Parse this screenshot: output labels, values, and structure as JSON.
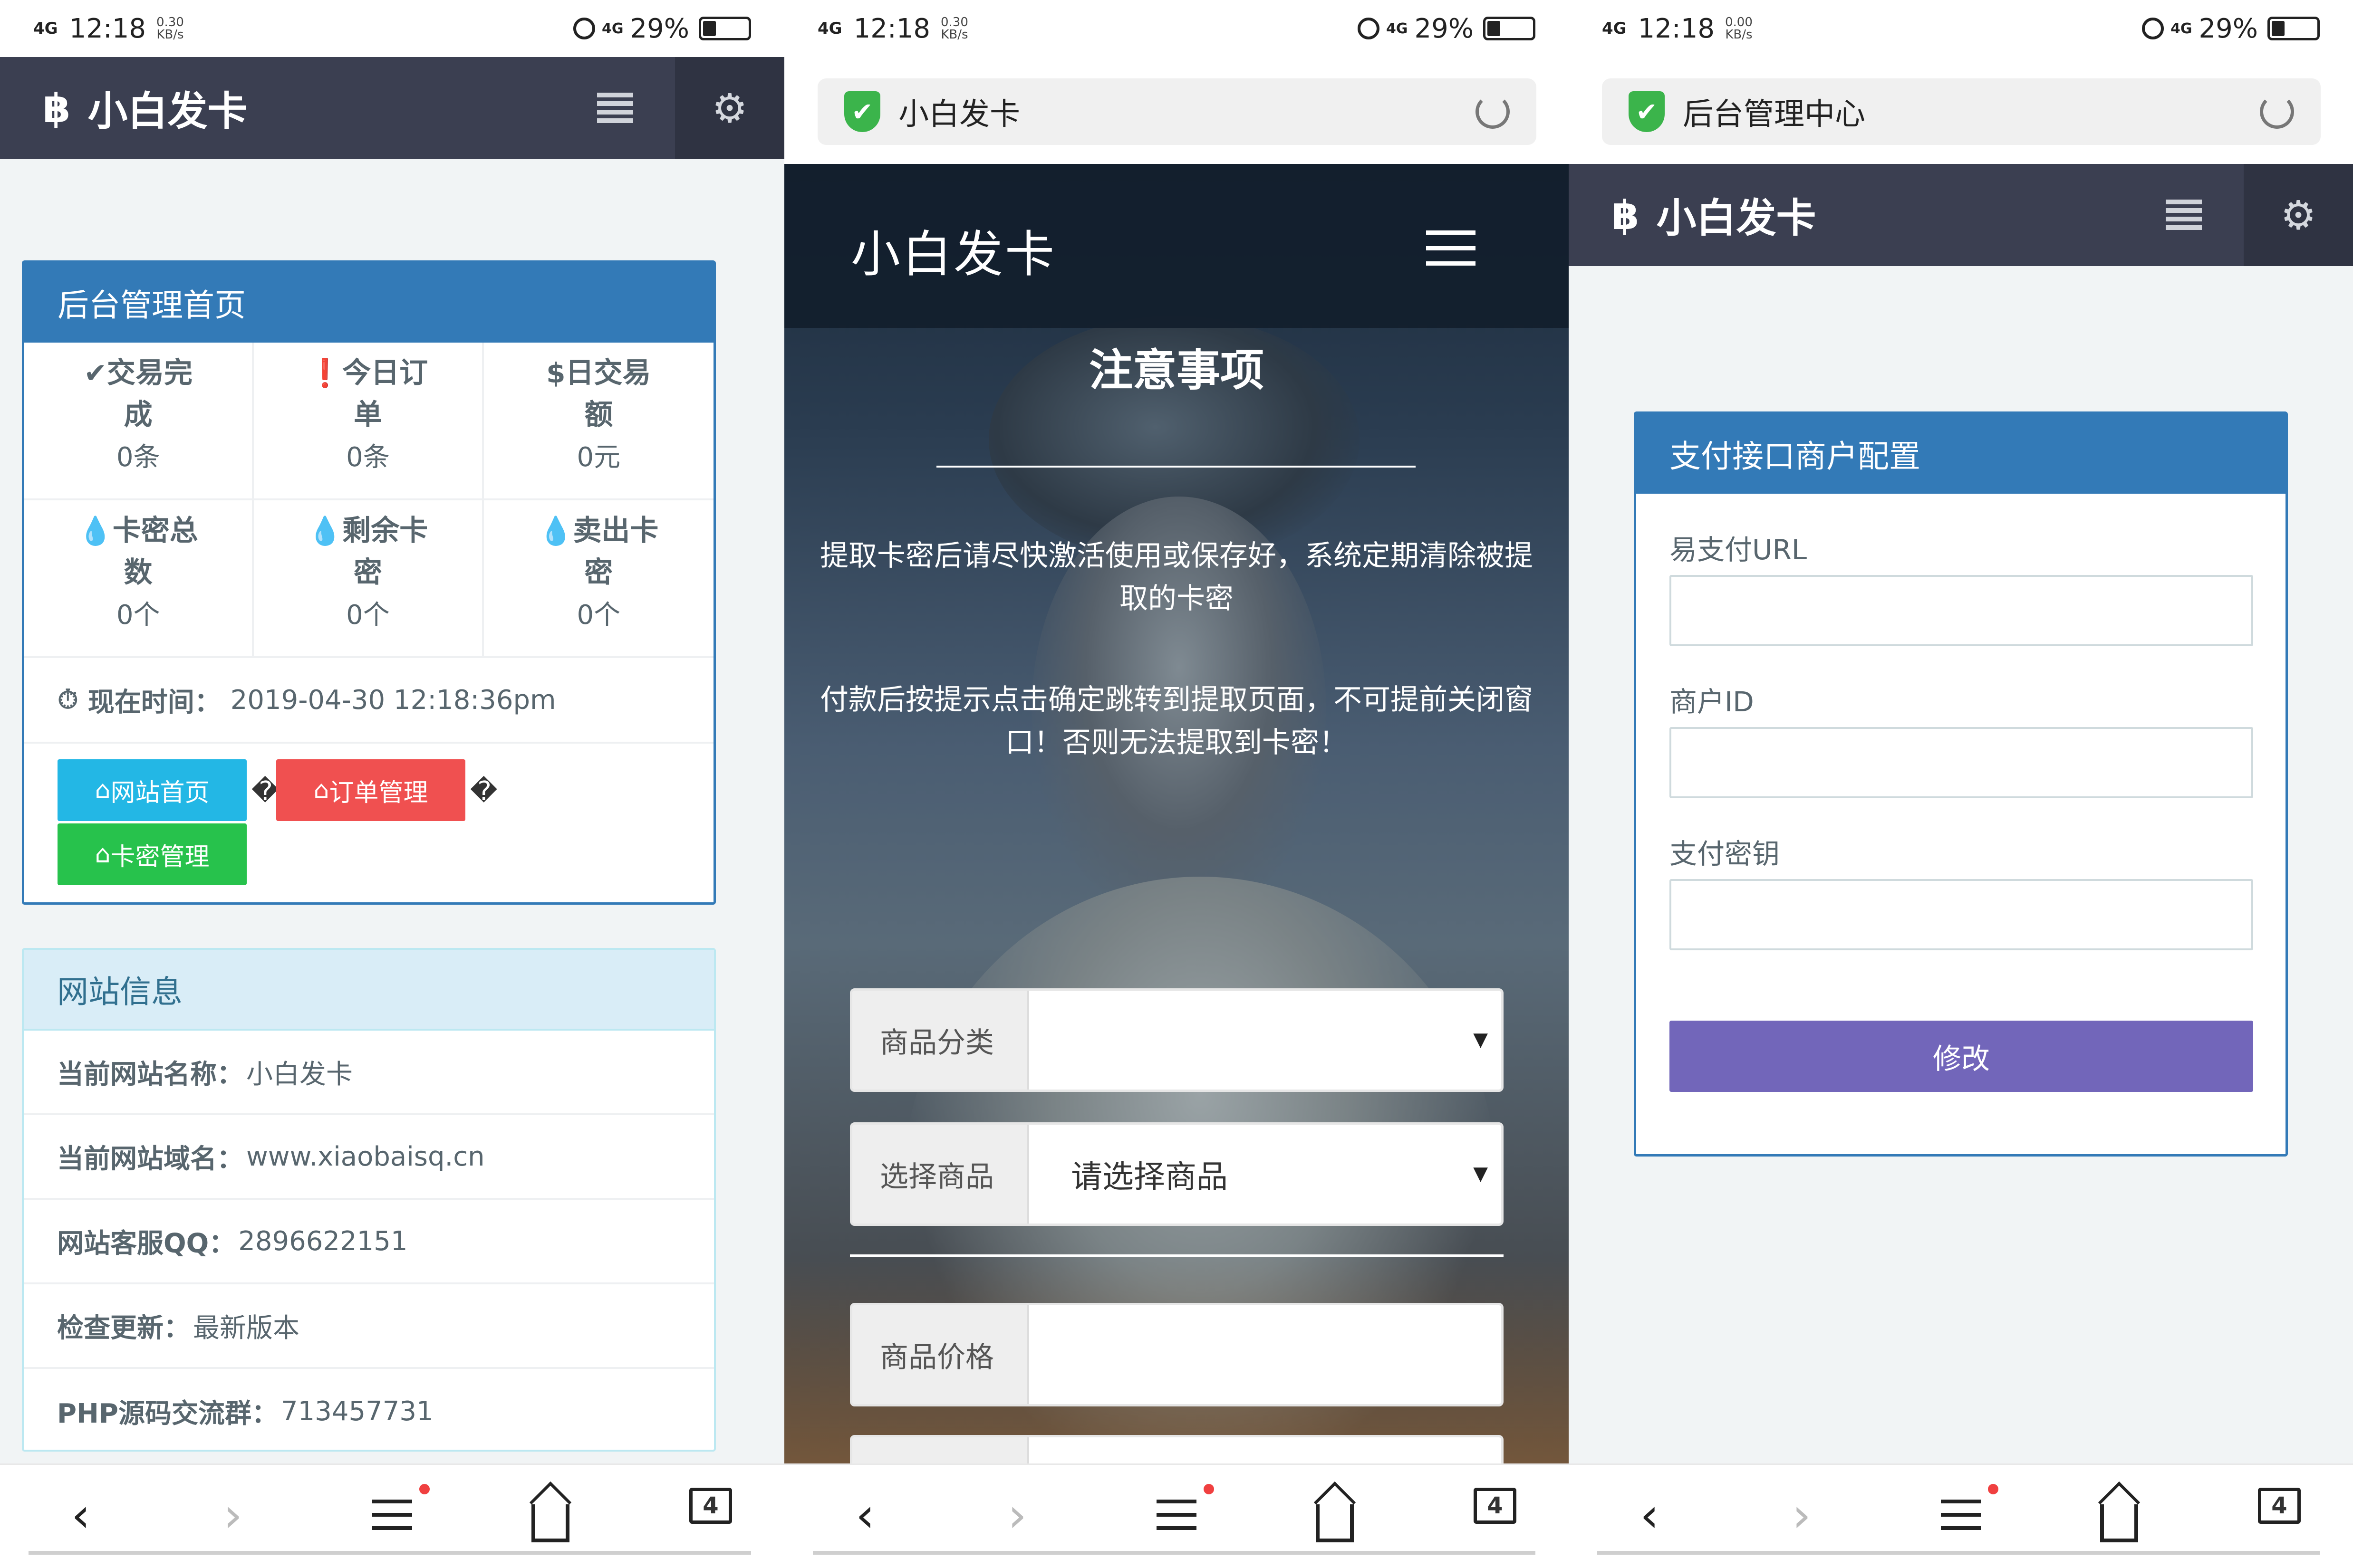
{
  "status_bar": {
    "signal": "4G",
    "time": "12:18",
    "speed_1": "0.30",
    "speed_2": "0.00",
    "speed_unit": "KB/s",
    "network": "4G",
    "battery": "29%",
    "battery_level": 0.29
  },
  "icons": {
    "brand": "bitcoin-icon",
    "menu": "hamburger-icon",
    "settings": "gear-icon",
    "secure": "shield-check-icon",
    "reload": "reload-icon",
    "back": "chevron-left-icon",
    "forward": "chevron-right-icon",
    "home": "home-icon",
    "tabs": "tabs-icon"
  },
  "glyphs": {
    "bitcoin": "฿",
    "gear": "⚙",
    "check": "✔",
    "back": "‹",
    "forward": "›",
    "caret": "▼",
    "clock": "⏱",
    "drop": "💧",
    "exclaim": "❗",
    "dollar": "$",
    "house": "⌂",
    "unknown": "�"
  },
  "colors": {
    "navbar": "#3b3f51",
    "panel_primary": "#337ab7",
    "info_header": "#d9edf7",
    "btn_info": "#23b7e5",
    "btn_danger": "#f05050",
    "btn_success": "#27c24c",
    "btn_submit": "#7266ba",
    "secure_green": "#3bb44b"
  },
  "panel1": {
    "brand": "小白发卡",
    "admin_panel": {
      "title": "后台管理首页",
      "stats": [
        {
          "label_1": "交易完",
          "label_2": "成",
          "value": "0条",
          "icon": "check-square-icon"
        },
        {
          "label_1": "今日订",
          "label_2": "单",
          "value": "0条",
          "icon": "exclamation-circle-icon"
        },
        {
          "label_1": "日交易",
          "label_2": "额",
          "value": "0元",
          "icon": "dollar-icon"
        },
        {
          "label_1": "卡密总",
          "label_2": "数",
          "value": "0个",
          "icon": "drop-icon"
        },
        {
          "label_1": "剩余卡",
          "label_2": "密",
          "value": "0个",
          "icon": "drop-icon"
        },
        {
          "label_1": "卖出卡",
          "label_2": "密",
          "value": "0个",
          "icon": "drop-icon"
        }
      ],
      "time_label": "现在时间：",
      "time_value": "2019-04-30 12:18:36pm",
      "buttons": {
        "site_home": "网站首页",
        "order_manage": "订单管理",
        "card_manage": "卡密管理"
      }
    },
    "site_info": {
      "title": "网站信息",
      "rows": [
        {
          "label": "当前网站名称：",
          "value": "小白发卡"
        },
        {
          "label": "当前网站域名：",
          "value": "www.xiaobaisq.cn"
        },
        {
          "label": "网站客服QQ：",
          "value": "2896622151"
        },
        {
          "label": "检查更新：",
          "value": "最新版本"
        },
        {
          "label": "PHP源码交流群：",
          "value": "713457731"
        }
      ]
    }
  },
  "panel2": {
    "url_title": "小白发卡",
    "site_title": "小白发卡",
    "notice_title": "注意事项",
    "notice_1": "提取卡密后请尽快激活使用或保存好，系统定期清除被提取的卡密",
    "notice_2": "付款后按提示点击确定跳转到提取页面，不可提前关闭窗口！否则无法提取到卡密！",
    "fields": {
      "category_label": "商品分类",
      "category_value": "",
      "product_label": "选择商品",
      "product_value": "请选择商品",
      "price_label": "商品价格"
    }
  },
  "panel3": {
    "url_title": "后台管理中心",
    "brand": "小白发卡",
    "form": {
      "title": "支付接口商户配置",
      "url_label": "易支付URL",
      "merchant_label": "商户ID",
      "key_label": "支付密钥",
      "submit": "修改"
    }
  },
  "bottom_nav": {
    "tab_count": "4",
    "has_notification": true
  }
}
